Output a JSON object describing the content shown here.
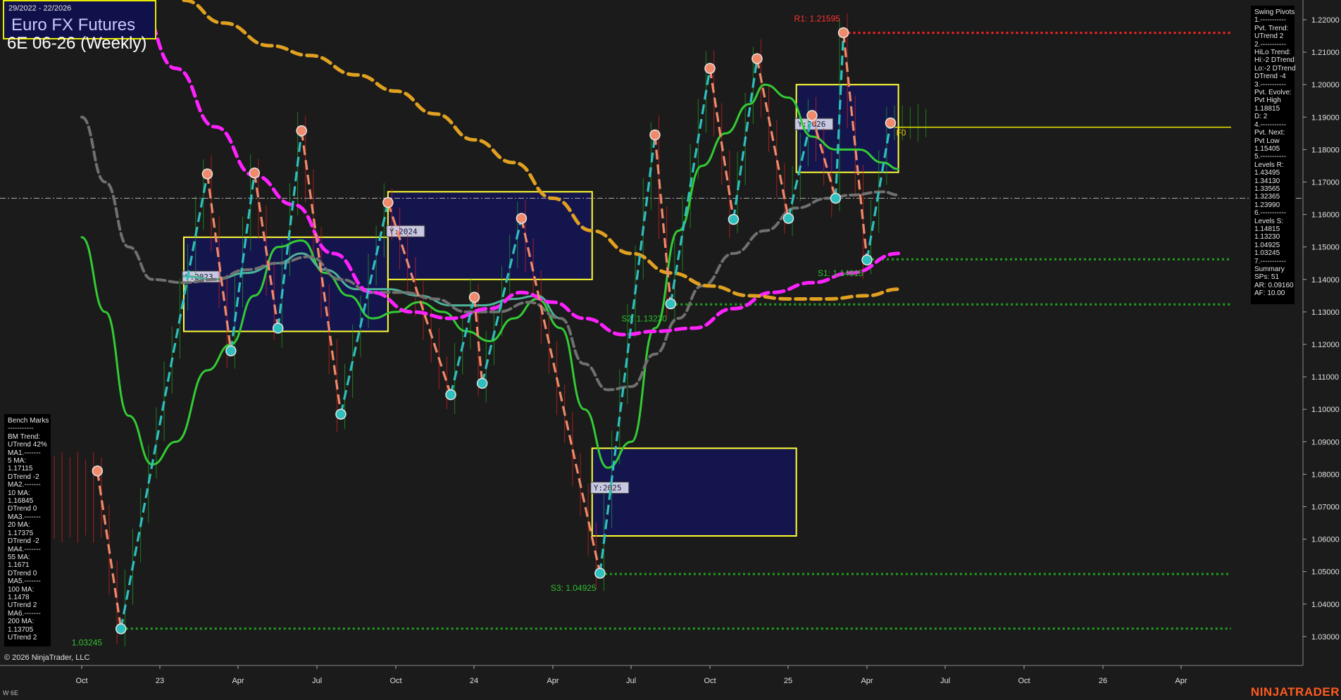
{
  "header": {
    "date_range": "29/2022 - 22/2026",
    "instrument_name": "Euro FX Futures",
    "contract": "6E 06-26 (Weekly)"
  },
  "copyright": "© 2026 NinjaTrader, LLC",
  "symbol_tag": "W 6E",
  "brand": "NINJATRADER",
  "benchmarks_panel": {
    "lines": [
      "Bench Marks",
      "-----------",
      "BM Trend:",
      "UTrend 42%",
      "MA1.-------",
      "5 MA:",
      "1.17115",
      "DTrend -2",
      "MA2.-------",
      "10 MA:",
      "1.16845",
      "DTrend 0",
      "MA3.-------",
      "20 MA:",
      "1.17375",
      "DTrend -2",
      "MA4.-------",
      "55 MA:",
      "1.1671",
      "DTrend 0",
      "MA5.-------",
      "100 MA:",
      "1.1478",
      "UTrend 2",
      "MA6.-------",
      "200 MA:",
      "1.13705",
      "UTrend 2"
    ]
  },
  "swing_panel": {
    "lines": [
      "Swing Pivots",
      "1.-----------",
      "Pvt. Trend:",
      "UTrend 2",
      "2.-----------",
      "HiLo Trend:",
      "Hi:-2 DTrend",
      "Lo:-2 DTrend",
      "DTrend -4",
      "3.-----------",
      "Pvt. Evolve:",
      "Pvt High",
      "1.18815",
      "D: 2",
      "4.-----------",
      "Pvt. Next:",
      "Pvt Low",
      "1.15405",
      "5.-----------",
      "Levels R:",
      "1.43495",
      "1.34130",
      "1.33565",
      "1.32365",
      "1.23990",
      "6.-----------",
      "Levels S:",
      "1.14815",
      "1.13230",
      "1.04925",
      "1.03245",
      "7.-----------",
      "Summary",
      "SPs: 51",
      "AR: 0.09160",
      "AF: 10.00"
    ]
  },
  "chart_data": {
    "type": "line",
    "title": "6E 06-26 (Weekly)",
    "x_tick_labels": [
      "Oct",
      "23",
      "Apr",
      "Jul",
      "Oct",
      "24",
      "Apr",
      "Jul",
      "Oct",
      "25",
      "Apr",
      "Jul",
      "Oct",
      "26",
      "Apr"
    ],
    "y_tick_labels": [
      "1.22000",
      "1.21000",
      "1.20000",
      "1.19000",
      "1.18000",
      "1.17000",
      "1.16000",
      "1.15000",
      "1.14000",
      "1.13000",
      "1.12000",
      "1.11000",
      "1.10000",
      "1.09000",
      "1.08000",
      "1.07000",
      "1.06000",
      "1.05000",
      "1.04000",
      "1.03000"
    ],
    "ylim": [
      1.025,
      1.2265
    ],
    "grid": false,
    "colors": {
      "background": "#1b1b1b",
      "up_bars": "#1f9e1f",
      "down_bars": "#d31f1f",
      "swing_up": "#2fbfbf",
      "swing_down": "#f08a6a",
      "ma_fast": "#33cc33",
      "ma_teal": "#4db39a",
      "ma_gray": "#707070",
      "ma_magenta": "#ff22ff",
      "ma_orange": "#e0a020",
      "year_box_fill": "#141454",
      "year_box_border": "#ffff33",
      "resistance": "#ff2222",
      "support": "#1fa01f"
    },
    "swing_pivots": [
      {
        "week": 2,
        "price": 1.081,
        "type": "high"
      },
      {
        "week": 5,
        "price": 1.0324,
        "type": "low"
      },
      {
        "week": 16,
        "price": 1.1725,
        "type": "high"
      },
      {
        "week": 19,
        "price": 1.118,
        "type": "low"
      },
      {
        "week": 22,
        "price": 1.1728,
        "type": "high"
      },
      {
        "week": 25,
        "price": 1.125,
        "type": "low"
      },
      {
        "week": 28,
        "price": 1.1858,
        "type": "high"
      },
      {
        "week": 33,
        "price": 1.0985,
        "type": "low"
      },
      {
        "week": 39,
        "price": 1.1637,
        "type": "high"
      },
      {
        "week": 47,
        "price": 1.1045,
        "type": "low"
      },
      {
        "week": 50,
        "price": 1.1345,
        "type": "high"
      },
      {
        "week": 51,
        "price": 1.108,
        "type": "low"
      },
      {
        "week": 56,
        "price": 1.1588,
        "type": "high"
      },
      {
        "week": 66,
        "price": 1.0495,
        "type": "low"
      },
      {
        "week": 73,
        "price": 1.1845,
        "type": "high"
      },
      {
        "week": 75,
        "price": 1.1325,
        "type": "low"
      },
      {
        "week": 80,
        "price": 1.205,
        "type": "high"
      },
      {
        "week": 83,
        "price": 1.1585,
        "type": "low"
      },
      {
        "week": 86,
        "price": 1.208,
        "type": "high"
      },
      {
        "week": 90,
        "price": 1.1588,
        "type": "low"
      },
      {
        "week": 93,
        "price": 1.1905,
        "type": "high"
      },
      {
        "week": 96,
        "price": 1.165,
        "type": "low"
      },
      {
        "week": 97,
        "price": 1.216,
        "type": "high"
      },
      {
        "week": 100,
        "price": 1.146,
        "type": "low"
      },
      {
        "week": 103,
        "price": 1.1882,
        "type": "high"
      }
    ],
    "level_lines": [
      {
        "label": "R1: 1.21595",
        "price": 1.21595,
        "kind": "resistance",
        "from_week": 97
      },
      {
        "label": "F0",
        "price": 1.1882,
        "kind": "pivot",
        "from_week": 103
      },
      {
        "label": "S1: 1.14815",
        "price": 1.1462,
        "kind": "support",
        "from_week": 100
      },
      {
        "label": "S2: 1.13230",
        "price": 1.1323,
        "kind": "support",
        "from_week": 75
      },
      {
        "label": "S3: 1.04925",
        "price": 1.04925,
        "kind": "support",
        "from_week": 66
      },
      {
        "label": "1.03245",
        "price": 1.03245,
        "kind": "support",
        "from_week": 5
      }
    ],
    "reference_line": {
      "price": 1.165
    },
    "year_boxes": [
      {
        "label": "Y:2023",
        "from_week": 13,
        "to_week": 39,
        "high": 1.153,
        "low": 1.124
      },
      {
        "label": "Y:2024",
        "from_week": 39,
        "to_week": 65,
        "high": 1.167,
        "low": 1.14
      },
      {
        "label": "Y:2025",
        "from_week": 65,
        "to_week": 91,
        "high": 1.088,
        "low": 1.061
      },
      {
        "label": "Y:2026",
        "from_week": 91,
        "to_week": 104,
        "high": 1.2,
        "low": 1.173
      }
    ],
    "moving_averages": [
      {
        "name": "5 MA",
        "color": "#33cc33",
        "points": [
          [
            0,
            1.153
          ],
          [
            3,
            1.13
          ],
          [
            6,
            1.098
          ],
          [
            9,
            1.083
          ],
          [
            12,
            1.09
          ],
          [
            16,
            1.112
          ],
          [
            19,
            1.12
          ],
          [
            22,
            1.135
          ],
          [
            25,
            1.15
          ],
          [
            28,
            1.152
          ],
          [
            31,
            1.142
          ],
          [
            34,
            1.135
          ],
          [
            37,
            1.128
          ],
          [
            40,
            1.13
          ],
          [
            43,
            1.133
          ],
          [
            46,
            1.13
          ],
          [
            49,
            1.124
          ],
          [
            52,
            1.121
          ],
          [
            55,
            1.128
          ],
          [
            58,
            1.134
          ],
          [
            61,
            1.125
          ],
          [
            64,
            1.1
          ],
          [
            67,
            1.082
          ],
          [
            70,
            1.09
          ],
          [
            73,
            1.125
          ],
          [
            76,
            1.155
          ],
          [
            79,
            1.175
          ],
          [
            82,
            1.185
          ],
          [
            85,
            1.194
          ],
          [
            87,
            1.2
          ],
          [
            90,
            1.196
          ],
          [
            93,
            1.184
          ],
          [
            96,
            1.18
          ],
          [
            99,
            1.18
          ],
          [
            102,
            1.176
          ],
          [
            104,
            1.174
          ]
        ]
      },
      {
        "name": "teal MA",
        "color": "#4db39a",
        "points": [
          [
            13,
            1.141
          ],
          [
            17,
            1.14
          ],
          [
            21,
            1.142
          ],
          [
            25,
            1.145
          ],
          [
            28,
            1.148
          ],
          [
            31,
            1.143
          ],
          [
            35,
            1.137
          ],
          [
            39,
            1.137
          ],
          [
            43,
            1.135
          ],
          [
            47,
            1.132
          ],
          [
            51,
            1.132
          ],
          [
            55,
            1.134
          ],
          [
            58,
            1.135
          ],
          [
            61,
            1.128
          ]
        ]
      },
      {
        "name": "gray MA",
        "color": "#707070",
        "points": [
          [
            0,
            1.19
          ],
          [
            3,
            1.17
          ],
          [
            6,
            1.15
          ],
          [
            9,
            1.14
          ],
          [
            13,
            1.139
          ],
          [
            17,
            1.14
          ],
          [
            21,
            1.143
          ],
          [
            25,
            1.145
          ],
          [
            29,
            1.147
          ],
          [
            33,
            1.14
          ],
          [
            37,
            1.136
          ],
          [
            41,
            1.136
          ],
          [
            45,
            1.134
          ],
          [
            49,
            1.13
          ],
          [
            53,
            1.13
          ],
          [
            57,
            1.133
          ],
          [
            61,
            1.128
          ],
          [
            64,
            1.114
          ],
          [
            67,
            1.106
          ],
          [
            70,
            1.107
          ],
          [
            73,
            1.117
          ],
          [
            76,
            1.128
          ],
          [
            79,
            1.138
          ],
          [
            83,
            1.148
          ],
          [
            87,
            1.155
          ],
          [
            91,
            1.162
          ],
          [
            95,
            1.165
          ],
          [
            98,
            1.166
          ],
          [
            102,
            1.167
          ],
          [
            104,
            1.166
          ]
        ]
      },
      {
        "name": "magenta MA",
        "color": "#ff22ff",
        "points": [
          [
            7,
            1.226
          ],
          [
            12,
            1.205
          ],
          [
            17,
            1.187
          ],
          [
            22,
            1.172
          ],
          [
            27,
            1.163
          ],
          [
            32,
            1.148
          ],
          [
            37,
            1.136
          ],
          [
            42,
            1.13
          ],
          [
            47,
            1.128
          ],
          [
            52,
            1.131
          ],
          [
            56,
            1.136
          ],
          [
            60,
            1.133
          ],
          [
            64,
            1.128
          ],
          [
            69,
            1.123
          ],
          [
            73,
            1.124
          ],
          [
            78,
            1.125
          ],
          [
            83,
            1.131
          ],
          [
            88,
            1.136
          ],
          [
            93,
            1.139
          ],
          [
            98,
            1.142
          ],
          [
            104,
            1.148
          ]
        ]
      },
      {
        "name": "orange MA",
        "color": "#e0a020",
        "points": [
          [
            13,
            1.226
          ],
          [
            18,
            1.219
          ],
          [
            24,
            1.212
          ],
          [
            29,
            1.209
          ],
          [
            35,
            1.203
          ],
          [
            40,
            1.198
          ],
          [
            45,
            1.191
          ],
          [
            50,
            1.183
          ],
          [
            55,
            1.176
          ],
          [
            60,
            1.165
          ],
          [
            65,
            1.155
          ],
          [
            70,
            1.148
          ],
          [
            75,
            1.142
          ],
          [
            80,
            1.138
          ],
          [
            85,
            1.135
          ],
          [
            90,
            1.134
          ],
          [
            95,
            1.134
          ],
          [
            100,
            1.135
          ],
          [
            104,
            1.137
          ]
        ]
      }
    ]
  }
}
